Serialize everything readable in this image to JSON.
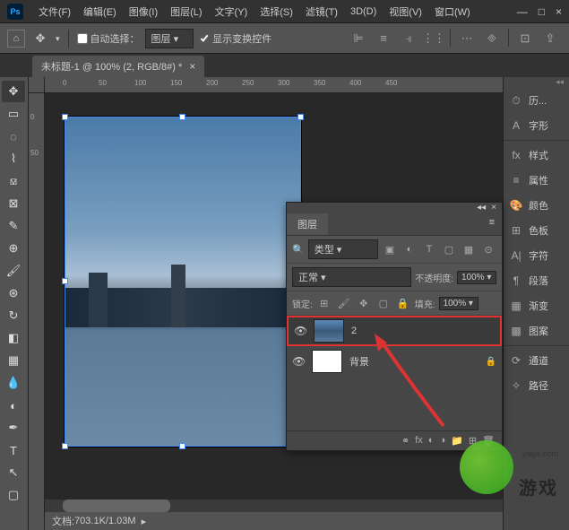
{
  "app": {
    "logo": "Ps"
  },
  "menu": [
    "文件(F)",
    "编辑(E)",
    "图像(I)",
    "图层(L)",
    "文字(Y)",
    "选择(S)",
    "滤镜(T)",
    "3D(D)",
    "视图(V)",
    "窗口(W)"
  ],
  "window_controls": {
    "min": "—",
    "max": "□",
    "close": "×"
  },
  "options": {
    "auto_select_label": "自动选择：",
    "target": "图层",
    "show_transform_label": "显示变换控件"
  },
  "document_tab": {
    "title": "未标题-1 @ 100% (2, RGB/8#) *"
  },
  "ruler_h": [
    0,
    50,
    100,
    150,
    200,
    250,
    300,
    350,
    400,
    450
  ],
  "ruler_v": [
    0,
    50
  ],
  "status": {
    "label": "文档:",
    "value": "703.1K/1.03M"
  },
  "right_panels": [
    {
      "icon": "⏱",
      "label": "历..."
    },
    {
      "icon": "A",
      "label": "字形"
    },
    {
      "icon": "fx",
      "label": "样式"
    },
    {
      "icon": "≡",
      "label": "属性"
    },
    {
      "icon": "🎨",
      "label": "颜色"
    },
    {
      "icon": "⊞",
      "label": "色板"
    },
    {
      "icon": "A|",
      "label": "字符"
    },
    {
      "icon": "¶",
      "label": "段落"
    },
    {
      "icon": "▦",
      "label": "渐变"
    },
    {
      "icon": "▩",
      "label": "图案"
    },
    {
      "icon": "⟳",
      "label": "通道"
    },
    {
      "icon": "✧",
      "label": "路径"
    }
  ],
  "layers_panel": {
    "tab": "图层",
    "filter_label": "类型",
    "blend_mode": "正常",
    "opacity_label": "不透明度:",
    "opacity_value": "100%",
    "lock_label": "锁定:",
    "fill_label": "填充:",
    "fill_value": "100%",
    "layers": [
      {
        "name": "2",
        "locked": false,
        "highlight": true
      },
      {
        "name": "背景",
        "locked": true,
        "highlight": false
      }
    ]
  },
  "watermark": {
    "url": "yiayx.com",
    "text": "游戏"
  }
}
